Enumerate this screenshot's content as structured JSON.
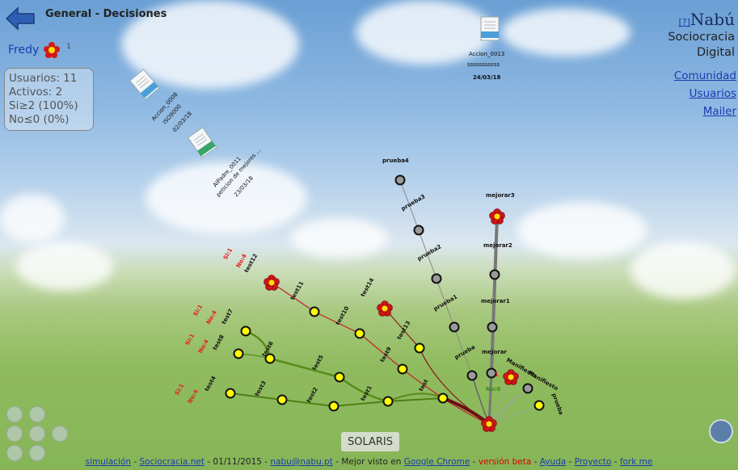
{
  "header": {
    "title": "General - Decisiones"
  },
  "user": {
    "name": "Fredy",
    "count": "1"
  },
  "stats": {
    "usuarios": "Usuarios: 11",
    "activos": "Activos: 2",
    "si": "Si≥2 (100%)",
    "no": "No≤0 (0%)"
  },
  "brand": {
    "help": "[?]",
    "name": "Nabú",
    "line1": "Sociocracia",
    "line2": "Digital"
  },
  "nav": {
    "comunidad": "Comunidad",
    "usuarios": "Usuarios",
    "mailer": "Mailer"
  },
  "docs": {
    "d1_label1": "Accion_0008",
    "d1_label2": "ISO9000",
    "d1_label3": "02/03/18",
    "d2_label1": "AlPadre_0011",
    "d2_label2": "peticion de mejores ...",
    "d2_label3": "23/03/18",
    "d3_label1": "Accion_0013",
    "d3_label2": "sssssssssss",
    "d3_label3": "24/03/18",
    "d1_tag": "Accion",
    "d2_tag": "Padre",
    "d3_tag": "Accion"
  },
  "graph": {
    "nodes": [
      {
        "label": "test12"
      },
      {
        "label": "test11"
      },
      {
        "label": "test10"
      },
      {
        "label": "test9"
      },
      {
        "label": "test14"
      },
      {
        "label": "test13"
      },
      {
        "label": "test7"
      },
      {
        "label": "test6"
      },
      {
        "label": "test5"
      },
      {
        "label": "test8"
      },
      {
        "label": "test4"
      },
      {
        "label": "test3"
      },
      {
        "label": "test2"
      },
      {
        "label": "test1"
      },
      {
        "label": "test"
      },
      {
        "label": "prueba4"
      },
      {
        "label": "prueba3"
      },
      {
        "label": "prueba2"
      },
      {
        "label": "prueba1"
      },
      {
        "label": "prueba"
      },
      {
        "label": "mejorar3"
      },
      {
        "label": "mejorar2"
      },
      {
        "label": "mejorar1"
      },
      {
        "label": "mejorar"
      },
      {
        "label": "Manifiesto"
      },
      {
        "label": "Manifiesto"
      },
      {
        "label": "prueba"
      }
    ],
    "vote_si": "Si:1",
    "vote_no": "No:4",
    "vote_no0": "No:0",
    "vote_one": "1"
  },
  "solaris": "SOLARIS",
  "footer": {
    "simulacion": "simulación",
    "sociocracia": "Sociocracia.net",
    "date": "01/11/2015",
    "email": "nabu@nabu.pt",
    "mejor": "Mejor visto en",
    "chrome": "Google Chrome",
    "beta": "versión beta",
    "ayuda": "Ayuda",
    "proyecto": "Proyecto",
    "fork": "fork me",
    "sep": " - "
  }
}
